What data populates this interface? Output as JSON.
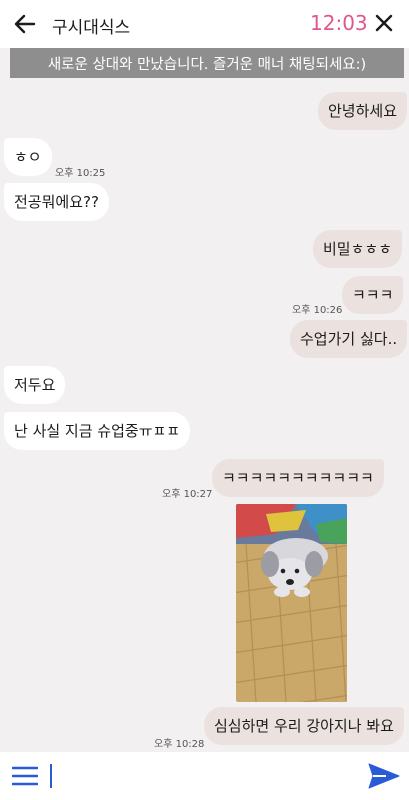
{
  "header": {
    "title": "구시대식스",
    "clock": "12:03",
    "accent_color": "#e0568f"
  },
  "banner": {
    "text": "새로운 상대와 만났습니다. 즐거운 매너 채팅되세요:)"
  },
  "messages": [
    {
      "side": "out",
      "text": "안녕하세요"
    },
    {
      "side": "in",
      "text": "ㅎㅇ",
      "time": "오후 10:25"
    },
    {
      "side": "in",
      "text": "전공뭐에요??"
    },
    {
      "side": "out",
      "text": "비밀ㅎㅎㅎ"
    },
    {
      "side": "out",
      "text": "ㅋㅋㅋ",
      "time": "오후 10:26"
    },
    {
      "side": "out",
      "text": "수업가기 싫다.."
    },
    {
      "side": "in",
      "text": "저두요"
    },
    {
      "side": "in",
      "text": "난 사실 지금 슈업중ㅠㅍㅍ"
    },
    {
      "side": "out",
      "text": "ㅋㅋㅋㅋㅋㅋㅋㅋㅋㅋㅋ",
      "time": "오후 10:27"
    },
    {
      "side": "out",
      "type": "image",
      "image_icon": "dog-photo"
    },
    {
      "side": "out",
      "text": "심심하면 우리 강아지나 봐요",
      "time": "오후 10:28"
    }
  ],
  "composer": {
    "menu_icon": "hamburger-menu-icon",
    "send_icon": "send-icon",
    "value": ""
  }
}
